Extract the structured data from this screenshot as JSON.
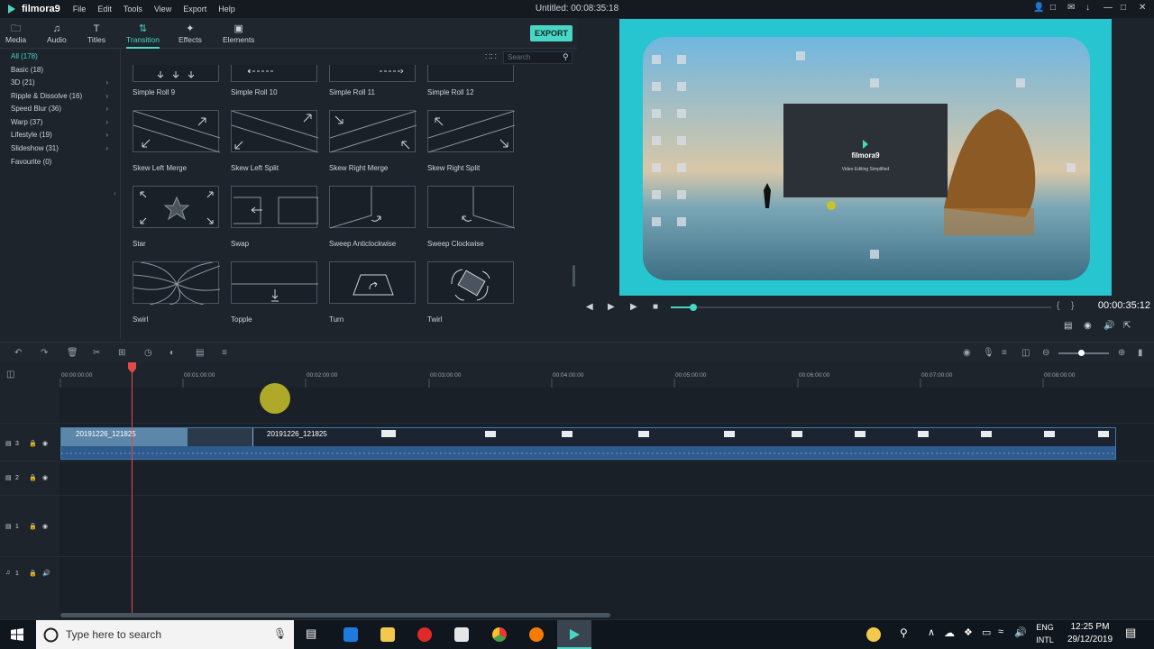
{
  "app": {
    "name": "filmora9",
    "menu": [
      "File",
      "Edit",
      "Tools",
      "View",
      "Export",
      "Help"
    ],
    "window_title": "Untitled:  00:08:35:18"
  },
  "tabs": [
    {
      "label": "Media",
      "icon": "folder-icon"
    },
    {
      "label": "Audio",
      "icon": "music-note-icon"
    },
    {
      "label": "Titles",
      "icon": "text-icon"
    },
    {
      "label": "Transition",
      "icon": "transition-icon",
      "active": true
    },
    {
      "label": "Effects",
      "icon": "effects-icon"
    },
    {
      "label": "Elements",
      "icon": "image-icon"
    }
  ],
  "export_label": "EXPORT",
  "search_placeholder": "Search",
  "categories": [
    {
      "label": "All (178)",
      "selected": true
    },
    {
      "label": "Basic (18)"
    },
    {
      "label": "3D (21)",
      "arrow": true
    },
    {
      "label": "Ripple & Dissolve (16)",
      "arrow": true
    },
    {
      "label": "Speed Blur (36)",
      "arrow": true
    },
    {
      "label": "Warp (37)",
      "arrow": true
    },
    {
      "label": "Lifestyle (19)",
      "arrow": true
    },
    {
      "label": "Slideshow (31)",
      "arrow": true
    },
    {
      "label": "Favourite (0)"
    }
  ],
  "transitions": [
    {
      "label": "Simple Roll 9"
    },
    {
      "label": "Simple Roll 10"
    },
    {
      "label": "Simple Roll 11"
    },
    {
      "label": "Simple Roll 12"
    },
    {
      "label": "Skew Left Merge"
    },
    {
      "label": "Skew Left Split"
    },
    {
      "label": "Skew Right Merge"
    },
    {
      "label": "Skew Right Split"
    },
    {
      "label": "Star"
    },
    {
      "label": "Swap"
    },
    {
      "label": "Sweep Anticlockwise"
    },
    {
      "label": "Sweep Clockwise"
    },
    {
      "label": "Swirl"
    },
    {
      "label": "Topple"
    },
    {
      "label": "Turn"
    },
    {
      "label": "Twirl"
    }
  ],
  "preview": {
    "splash_title": "filmora9",
    "splash_subtitle": "Video Editing Simplified",
    "timecode": "00:00:35:12",
    "progress": 0.06
  },
  "timeline": {
    "ruler": [
      "00:00:00:00",
      "00:01:00:00",
      "00:02:00:00",
      "00:03:00:00",
      "00:04:00:00",
      "00:05:00:00",
      "00:06:00:00",
      "00:07:00:00",
      "00:08:00:00"
    ],
    "tracks": [
      {
        "num": "3",
        "type": "video"
      },
      {
        "num": "2",
        "type": "video"
      },
      {
        "num": "1",
        "type": "video"
      },
      {
        "num": "1",
        "type": "audio"
      }
    ],
    "clip_labels": [
      "20191226_121825",
      "20191226_121825"
    ]
  },
  "taskbar": {
    "search_placeholder": "Type here to search",
    "language": "ENG",
    "region": "INTL",
    "time": "12:25 PM",
    "date": "29/12/2019"
  },
  "colors": {
    "accent": "#49d6c4",
    "clip": "#2f5b8e",
    "playhead": "#e24a4a"
  }
}
